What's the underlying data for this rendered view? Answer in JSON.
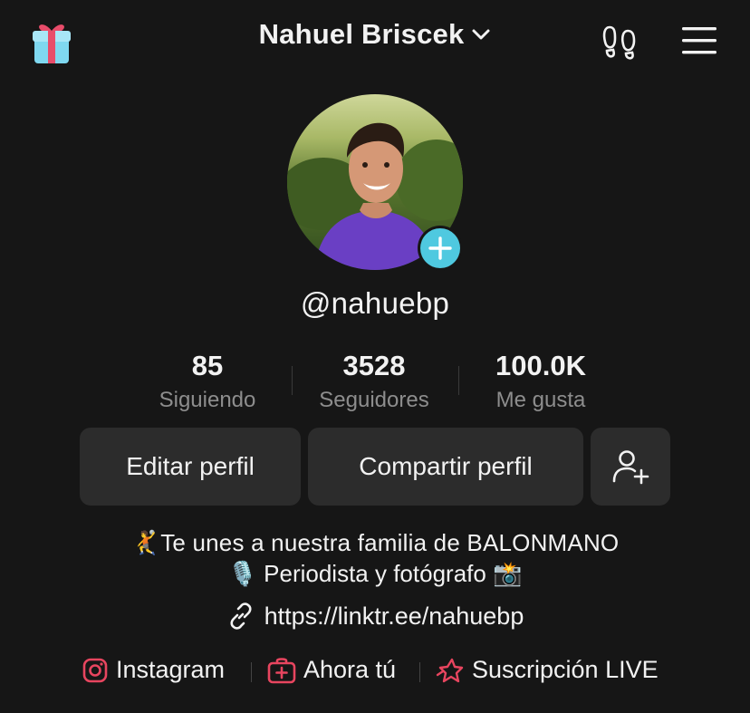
{
  "header": {
    "username_title": "Nahuel Briscek",
    "icons": [
      "gift-icon",
      "footprints-icon",
      "menu-icon",
      "chevron-down-icon"
    ]
  },
  "profile": {
    "handle": "@nahuebp"
  },
  "stats": [
    {
      "value": "85",
      "label": "Siguiendo"
    },
    {
      "value": "3528",
      "label": "Seguidores"
    },
    {
      "value": "100.0K",
      "label": "Me gusta"
    }
  ],
  "actions": {
    "edit": "Editar perfil",
    "share": "Compartir perfil"
  },
  "bio": {
    "line1_text": "Te unes a nuestra familia de BALONMANO",
    "line2_text": " Periodista y fotógrafo ",
    "line1_emoji": "🤾",
    "line2_emoji_left": "🎙️",
    "line2_emoji_right": "📸",
    "link": "https://linktr.ee/nahuebp"
  },
  "social": {
    "instagram": "Instagram",
    "ahora": "Ahora tú",
    "live": "Suscripción LIVE"
  },
  "colors": {
    "background": "#161616",
    "button_bg": "#2c2c2c",
    "accent_plus": "#4fc9e0",
    "accent_red": "#e8455f",
    "muted_text": "#8d8d8d"
  }
}
